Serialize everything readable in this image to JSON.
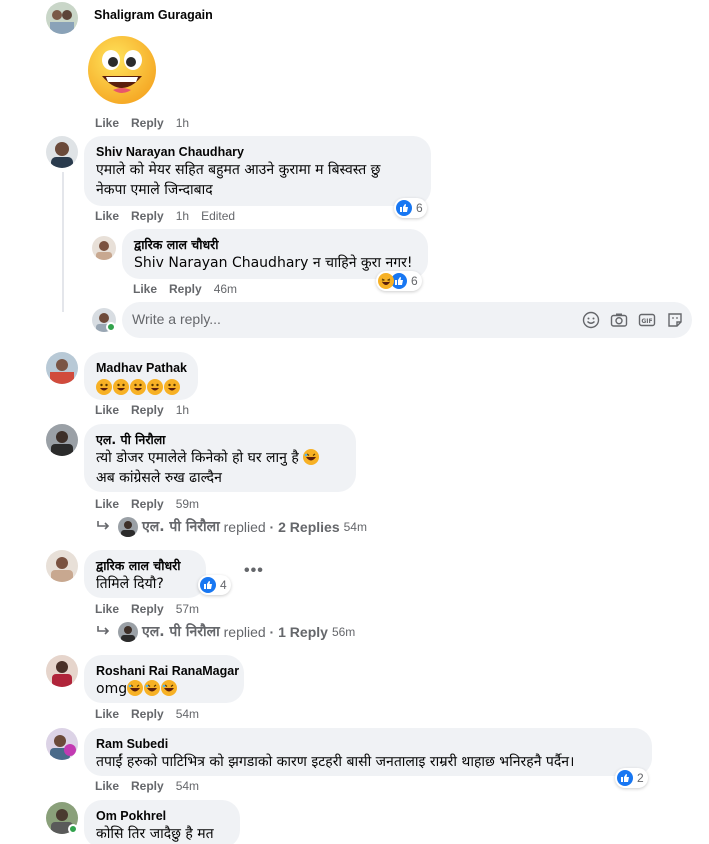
{
  "ui": {
    "like": "Like",
    "reply": "Reply",
    "edited": "Edited",
    "replied": "replied",
    "write_reply_placeholder": "Write a reply...",
    "accent": "#1877f2",
    "text_secondary": "#65676b",
    "bubble_bg": "#f0f2f5"
  },
  "comments": [
    {
      "author": "Shaligram Guragain",
      "sticker": "grinning-face-sticker",
      "time": "1h"
    },
    {
      "author": "Shiv Narayan Chaudhary",
      "lines": [
        "एमाले को मेयर सहित बहुमत आउने कुरामा म बिस्वस्त छु",
        "नेकपा एमाले जिन्दाबाद"
      ],
      "time": "1h",
      "reactions": "6"
    },
    {
      "author": "द्वारिक लाल चौधरी",
      "tag": "Shiv Narayan Chaudhary",
      "lines": [
        " न चाहिने कुरा नगर!"
      ],
      "time": "46m",
      "reactions": "6"
    },
    {
      "author": "Madhav Pathak",
      "time": "1h"
    },
    {
      "author": "एल. पी निरौला",
      "lines": [
        "त्यो डोजर एमालेले किनेको हो घर लानु है",
        "अब कांग्रेसले रुख ढाल्दैन"
      ],
      "time": "59m"
    },
    {
      "author": "द्वारिक लाल चौधरी",
      "lines": [
        "तिमिले दियौ?"
      ],
      "time": "57m",
      "reactions": "4"
    },
    {
      "author": "Roshani Rai RanaMagar",
      "lines": [
        "omg"
      ],
      "time": "54m"
    },
    {
      "author": "Ram Subedi",
      "lines": [
        "तपाईं हरुको पाटिभित्र को झगडाको कारण इटहरी बासी जनतालाइ राम्ररी थाहाछ भनिरहनै पर्दैन।"
      ],
      "time": "54m",
      "reactions": "2"
    },
    {
      "author": "Om Pokhrel",
      "lines": [
        "कोसि तिर जादैछु है मत"
      ]
    }
  ],
  "reply_threads": [
    {
      "author": "एल. पी निरौला",
      "count": "2 Replies",
      "time": "54m"
    },
    {
      "author": "एल. पी निरौला",
      "count": "1 Reply",
      "time": "56m"
    }
  ]
}
